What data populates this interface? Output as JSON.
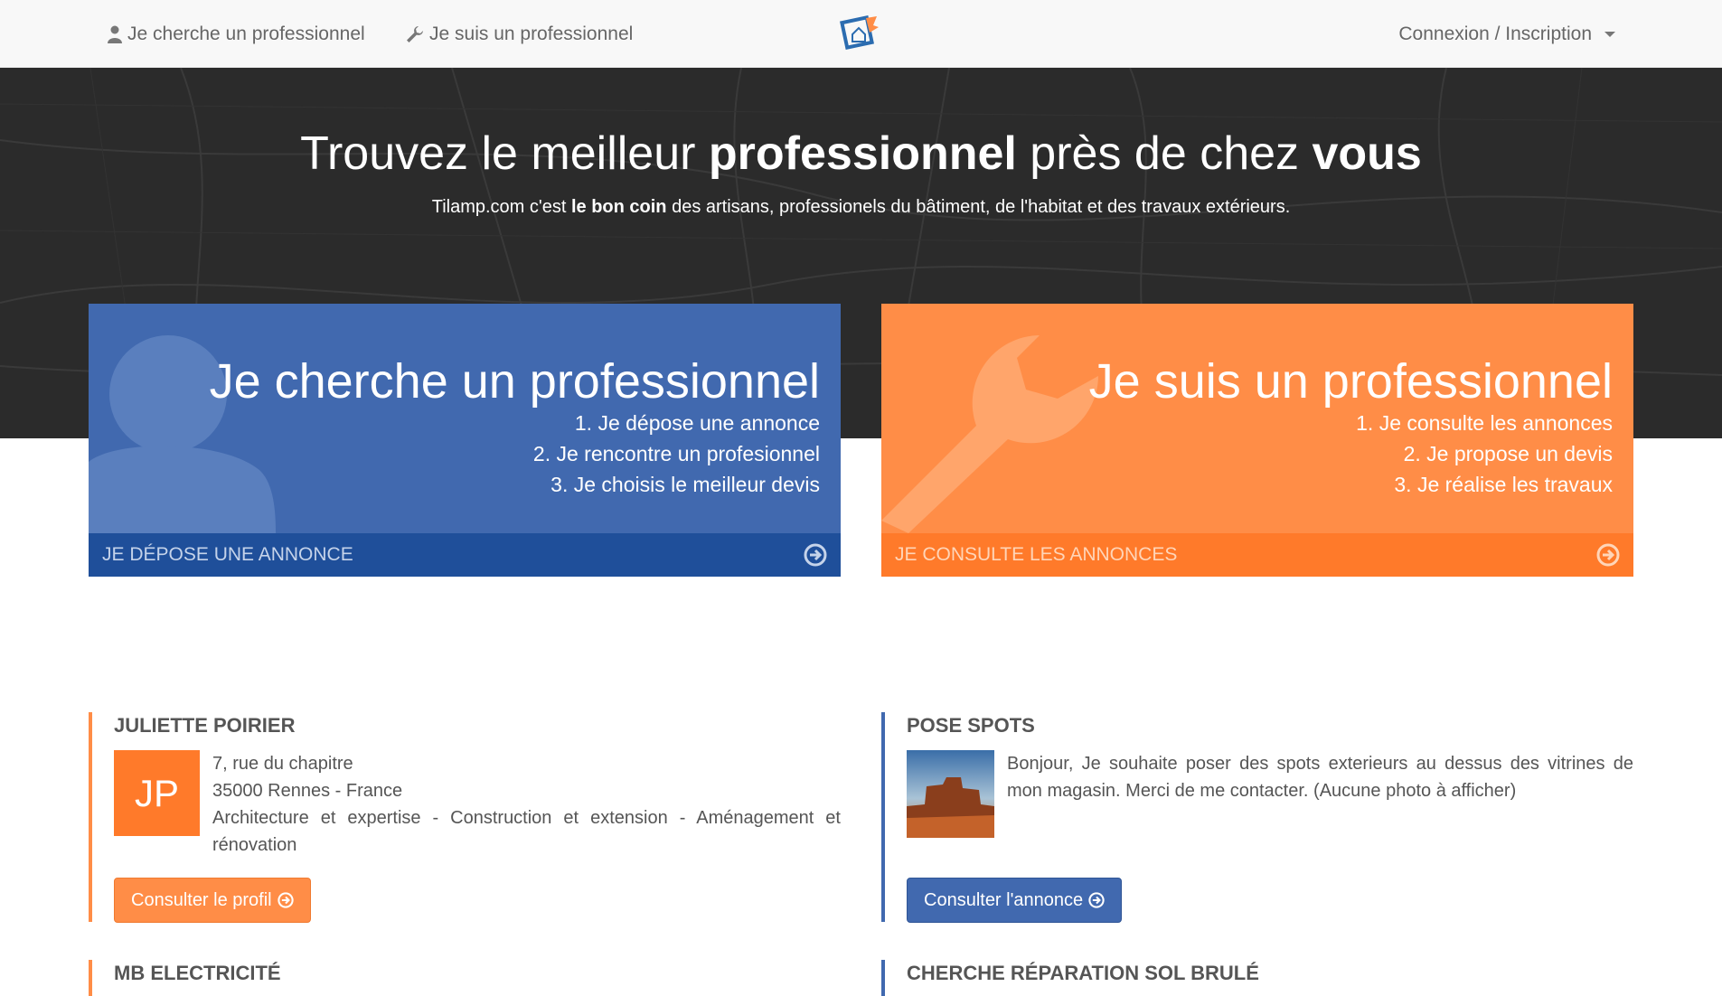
{
  "nav": {
    "seek_label": "Je cherche un professionnel",
    "pro_label": "Je suis un professionnel",
    "account_label": "Connexion / Inscription"
  },
  "hero": {
    "title_part1": "Trouvez le meilleur ",
    "title_bold1": "professionnel",
    "title_part2": " près de chez ",
    "title_bold2": "vous",
    "sub_part1": "Tilamp.com c'est ",
    "sub_bold": "le bon coin",
    "sub_part2": " des artisans, professionels du bâtiment, de l'habitat et des travaux extérieurs."
  },
  "cards": {
    "seek": {
      "title": "Je cherche un professionnel",
      "steps": [
        "1. Je dépose une annonce",
        "2. Je rencontre un profesionnel",
        "3. Je choisis le meilleur devis"
      ],
      "footer": "JE DÉPOSE UNE ANNONCE"
    },
    "pro": {
      "title": "Je suis un professionnel",
      "steps": [
        "1. Je consulte les annonces",
        "2. Je propose un devis",
        "3. Je réalise les travaux"
      ],
      "footer": "JE CONSULTE LES ANNONCES"
    }
  },
  "listings": {
    "pro1": {
      "title": "JULIETTE POIRIER",
      "initials": "JP",
      "address": "7, rue du chapitre",
      "city": "35000 Rennes - France",
      "categories": "Architecture et expertise - Construction et extension - Aménagement et rénovation",
      "button": "Consulter le profil"
    },
    "ad1": {
      "title": "POSE SPOTS",
      "description": "Bonjour, Je souhaite poser des spots exterieurs au dessus des vitrines de mon magasin. Merci de me contacter. (Aucune photo à afficher)",
      "button": "Consulter l'annonce"
    },
    "pro2": {
      "title": "MB ELECTRICITÉ"
    },
    "ad2": {
      "title": "CHERCHE RÉPARATION SOL BRULÉ"
    }
  },
  "colors": {
    "blue": "#4169af",
    "blue_dark": "#1f4f9a",
    "orange": "#ff8d47",
    "orange_dark": "#ff7a2a"
  }
}
